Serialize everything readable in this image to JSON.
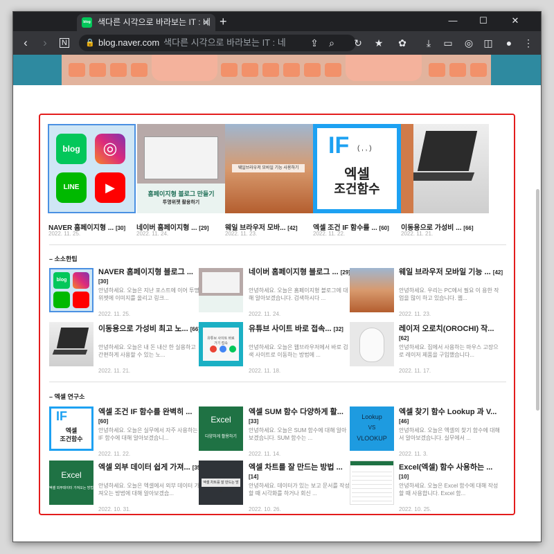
{
  "browser": {
    "tab_title": "색다른 시각으로 바라보는 IT : 네",
    "favicon_text": "blog",
    "url": "blog.naver.com",
    "page_title": "색다른 시각으로 바라보는 IT : 네"
  },
  "top_posts": [
    {
      "title": "NAVER 홈페이지형 ...",
      "count": "[30]",
      "date": "2022. 11. 25."
    },
    {
      "title": "네이버 홈페이지형 ...",
      "count": "[29]",
      "date": "2022. 11. 24."
    },
    {
      "title": "웨일 브라우저 모바...",
      "count": "[42]",
      "date": "2022. 11. 23."
    },
    {
      "title": "엑셀 조건 IF 함수를 ...",
      "count": "[60]",
      "date": "2022. 11. 22."
    },
    {
      "title": "이동용으로 가성비 ...",
      "count": "[66]",
      "date": "2022. 11. 21."
    }
  ],
  "thumb_texts": {
    "homepage_blog": "홈페이지형 블로그 만들기",
    "homepage_blog_sub": "투명위젯 활용하기",
    "whale_caption": "웨일브라우저 모바일 기능 사용하기",
    "if_big": "IF",
    "if_args": "( , , )",
    "if_excel": "엑셀",
    "if_func": "조건함수",
    "youtube_caption": "유튜브 사이트 바로가기 접속",
    "excel": "Excel",
    "excel_sum_sub": "다양하게 활용하기",
    "lookup1": "Lookup",
    "lookup2": "VS",
    "lookup3": "VLOOKUP",
    "excel_ext_sub": "엑셀 외부데이터 가져오는 방법",
    "chart_caption": "엑셀 차트를 잘 만드는 방법"
  },
  "sections": [
    {
      "title": "– 소소한팁",
      "items": [
        {
          "title": "NAVER 홈페이지형 블로그 ...",
          "count": "[30]",
          "desc": "안녕하세요. 오늘은 지난 포스트에 이어 투명 위젯에 이미지를 올리고 링크...",
          "date": "2022. 11. 25."
        },
        {
          "title": "네이버 홈페이지형 블로그 ...",
          "count": "[29]",
          "desc": "안녕하세요. 오늘은 홈페이지형 블로그에 대해 알아보겠습니다. 검색하시다 ...",
          "date": "2022. 11. 24."
        },
        {
          "title": "웨일 브라우저 모바일 기능 ...",
          "count": "[42]",
          "desc": "안녕하세요. 우리는 PC에서 필요 이 용한 작업을 많이 하고 있습니다. 웹...",
          "date": "2022. 11. 23."
        },
        {
          "title": "이동용으로 가성비 최고 노...",
          "count": "[66]",
          "desc": "안녕하세요. 오늘은 내 돈 내산 한 실용하고 간편하게 사용할 수 있는 노...",
          "date": "2022. 11. 21."
        },
        {
          "title": "유튜브 사이트 바로 접속...",
          "count": "[32]",
          "desc": "안녕하세요. 오늘은 웹브라우저에서 바로 검색 사이트로 이동하는 방법에 ...",
          "date": "2022. 11. 18."
        },
        {
          "title": "레이저 오로치(OROCHI) 작...",
          "count": "[62]",
          "desc": "안녕하세요. 집에서 사용하는 마우스 고장으로 레이저 제품을 구입했습니다...",
          "date": "2022. 11. 17."
        }
      ]
    },
    {
      "title": "– 엑셀 연구소",
      "items": [
        {
          "title": "엑셀 조건 IF 함수를 완벽히 ...",
          "count": "[60]",
          "desc": "안녕하세요. 오늘은 실무에서 자주 사용하는 IF 함수에 대해 알아보겠습니...",
          "date": "2022. 11. 22."
        },
        {
          "title": "엑셀 SUM 함수 다양하게 활...",
          "count": "[33]",
          "desc": "안녕하세요. 오늘은 SUM 함수에 대해 알아보겠습니다. SUM 함수는 ...",
          "date": "2022. 11. 14."
        },
        {
          "title": "엑셀 찾기 함수 Lookup 과 V...",
          "count": "[46]",
          "desc": "안녕하세요. 오늘은 엑셀의 찾기 함수에 대해서 알아보겠습니다. 실무에서 ...",
          "date": "2022. 11. 3."
        },
        {
          "title": "엑셀 외부 데이터 쉽게 가져...",
          "count": "[35]",
          "desc": "안녕하세요. 오늘은 엑셀에서 외부 데이터 가져오는 방법에 대해 알아보겠습...",
          "date": "2022. 10. 31."
        },
        {
          "title": "엑셀 차트를 잘 만드는 방법 ...",
          "count": "[14]",
          "desc": "안녕하세요. 데이터가 있는 보고 문서를 작성할 때 시각화를 하거나 회신 ...",
          "date": "2022. 10. 26."
        },
        {
          "title": "Excel(엑셀) 함수 사용하는 ...",
          "count": "[10]",
          "desc": "안녕하세요. 오늘은 Excel 함수에 대해 작성할 때 사용합니다. Excel 함...",
          "date": "2022. 10. 25."
        }
      ]
    }
  ],
  "colors": {
    "highlight_border": "#e31c1c",
    "naver_green": "#03c75a",
    "if_blue": "#1da1f2"
  }
}
